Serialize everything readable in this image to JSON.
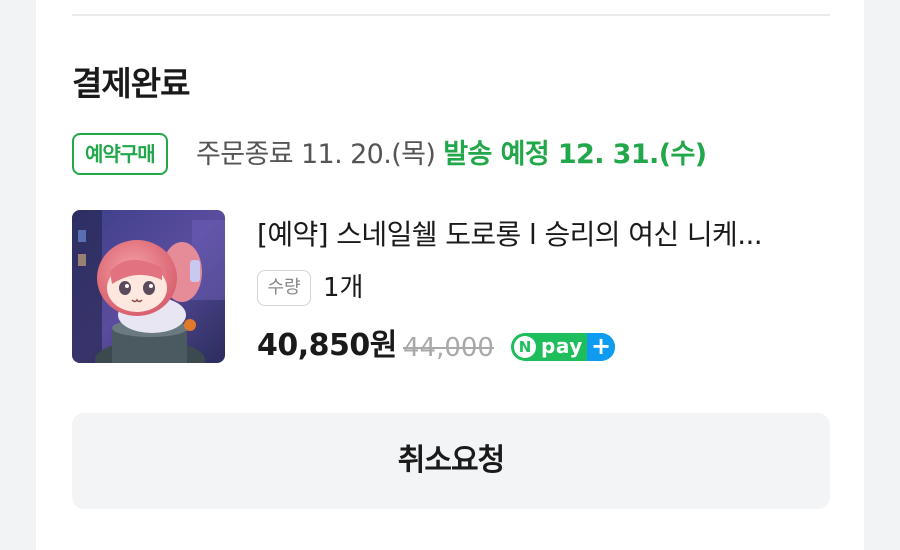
{
  "order": {
    "status": "결제완료",
    "badge": "예약구매",
    "order_end": "주문종료 11. 20.(목)",
    "ship_date": "발송 예정 12. 31.(수)"
  },
  "product": {
    "title": "[예약] 스네일쉘 도로롱 l 승리의 여신 니케...",
    "quantity_label": "수량",
    "quantity_value": "1개",
    "price": "40,850원",
    "original_price": "44,000",
    "npay": {
      "n": "N",
      "text": "pay",
      "plus": "+"
    }
  },
  "actions": {
    "cancel_label": "취소요청"
  },
  "colors": {
    "accent_green": "#22a84a",
    "npay_green": "#1fbe5c",
    "npay_blue": "#0e9bf0"
  },
  "icons": {
    "npay_badge": "npay-plus-icon",
    "product_image": "figure-thumbnail"
  }
}
